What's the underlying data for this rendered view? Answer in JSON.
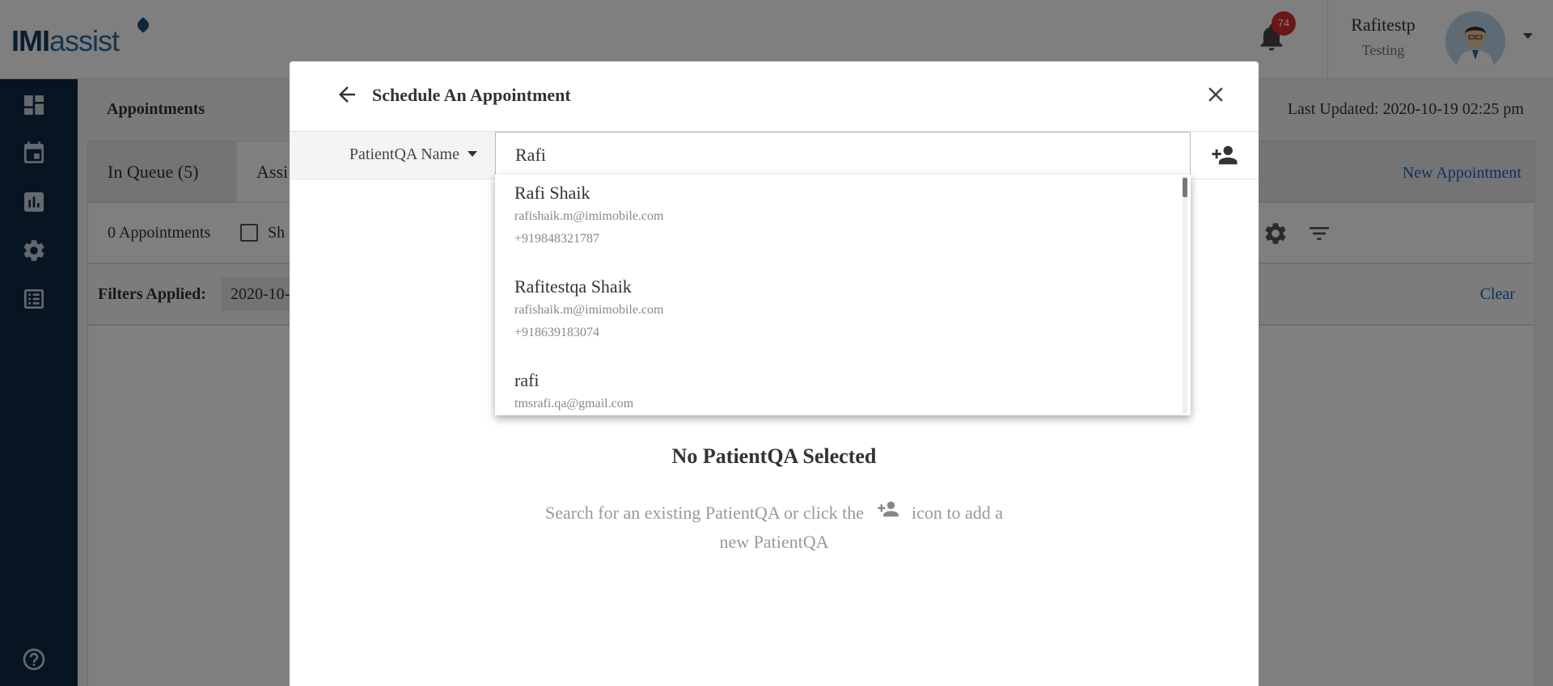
{
  "app": {
    "logo_bold": "IMI",
    "logo_light": "assist",
    "notifications_count": "74",
    "user_name": "Rafitestp",
    "user_role": "Testing"
  },
  "page": {
    "breadcrumb": "Appointments",
    "last_updated": "Last Updated: 2020-10-19 02:25 pm",
    "tabs": [
      {
        "label": "In Queue (5)"
      },
      {
        "label": "Assi"
      }
    ],
    "new_appointment": "New Appointment",
    "appointments_count": "0 Appointments",
    "show_label": "Sh",
    "filters_label": "Filters Applied:",
    "filter_chip": "2020-10-",
    "clear": "Clear"
  },
  "modal": {
    "title": "Schedule An Appointment",
    "field_select": "PatientQA Name",
    "search_value": "Rafi",
    "results": [
      {
        "name": "Rafi Shaik",
        "email": "rafishaik.m@imimobile.com",
        "phone": "+919848321787"
      },
      {
        "name": "Rafitestqa Shaik",
        "email": "rafishaik.m@imimobile.com",
        "phone": "+918639183074"
      },
      {
        "name": "rafi",
        "email": "tmsrafi.qa@gmail.com",
        "phone": ""
      }
    ],
    "empty_title": "No PatientQA Selected",
    "empty_text_before": "Search for an existing PatientQA or click the",
    "empty_text_after": "icon to add a new PatientQA"
  },
  "colors": {
    "sidebar": "#0f2a44",
    "link": "#1565c0",
    "badge": "#d32f2f"
  },
  "icons": [
    "dashboard-icon",
    "calendar-icon",
    "chart-icon",
    "gear-icon",
    "list-icon",
    "help-icon",
    "bell-icon",
    "back-arrow-icon",
    "close-icon",
    "add-person-icon",
    "filter-icon"
  ]
}
